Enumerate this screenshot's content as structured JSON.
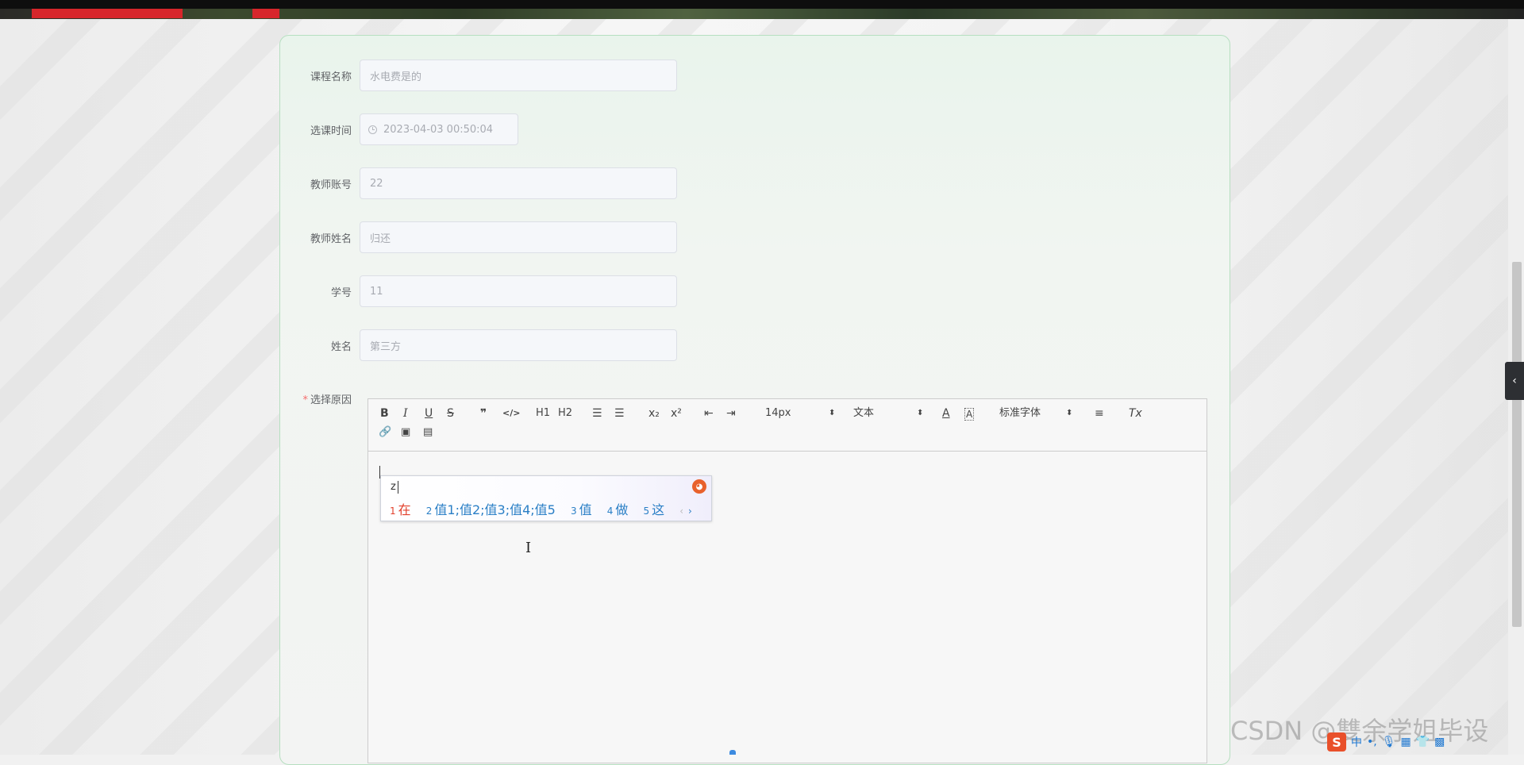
{
  "form": {
    "course_name": {
      "label": "课程名称",
      "value": "水电费是的"
    },
    "select_time": {
      "label": "选课时间",
      "value": "2023-04-03 00:50:04"
    },
    "teacher_account": {
      "label": "教师账号",
      "value": "22"
    },
    "teacher_name": {
      "label": "教师姓名",
      "value": "归还"
    },
    "student_id": {
      "label": "学号",
      "value": "11"
    },
    "student_name": {
      "label": "姓名",
      "value": "第三方"
    },
    "reason": {
      "label": "选择原因",
      "required_mark": "*"
    }
  },
  "editor": {
    "toolbar": {
      "bold": "B",
      "italic": "I",
      "underline": "U",
      "strike": "S",
      "quote": "❞",
      "code": "</>",
      "h1": "H1",
      "h2": "H2",
      "ordered_list": "☰",
      "bullet_list": "☰",
      "sub": "x₂",
      "sup": "x²",
      "outdent": "⇤",
      "indent": "⇥",
      "font_size": "14px",
      "header_select": "文本",
      "font_color": "A",
      "bg_color": "A",
      "font_family": "标准字体",
      "align": "≡",
      "clean": "Tx",
      "link": "🔗",
      "image": "▣",
      "video": "▤"
    }
  },
  "ime": {
    "composition": "z",
    "candidates": [
      {
        "num": "1",
        "text": "在"
      },
      {
        "num": "2",
        "text": "值1;值2;值3;值4;值5"
      },
      {
        "num": "3",
        "text": "值"
      },
      {
        "num": "4",
        "text": "做"
      },
      {
        "num": "5",
        "text": "这"
      }
    ],
    "prev": "‹",
    "next": "›"
  },
  "watermark": "CSDN @雙余学姐毕设",
  "tray": {
    "logo": "S",
    "icons": [
      "中",
      "•,",
      "🎙",
      "▦",
      "👕",
      "▩"
    ]
  },
  "sidebar_toggle": "‹"
}
